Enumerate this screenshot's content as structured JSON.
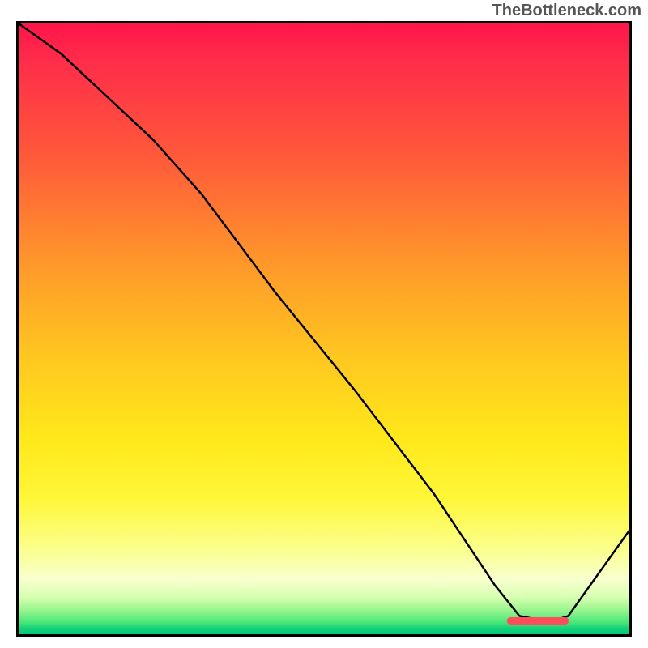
{
  "watermark": "TheBottleneck.com",
  "colors": {
    "top": "#ff154a",
    "mid": "#ffe81a",
    "bottom_band": "#00c97a",
    "line": "#000000",
    "marker": "#ff4d5a",
    "border": "#000000"
  },
  "chart_data": {
    "type": "line",
    "title": "",
    "xlabel": "",
    "ylabel": "",
    "xlim": [
      0,
      100
    ],
    "ylim": [
      0,
      100
    ],
    "grid": false,
    "legend": false,
    "x": [
      0,
      7,
      22,
      30,
      42,
      55,
      68,
      78,
      82,
      87,
      90,
      100
    ],
    "values": [
      100,
      95,
      81,
      72,
      56,
      40,
      23,
      8,
      3,
      2,
      3,
      17
    ],
    "optimal_zone": {
      "x_start": 80,
      "x_end": 90,
      "y": 2
    },
    "annotations": []
  }
}
